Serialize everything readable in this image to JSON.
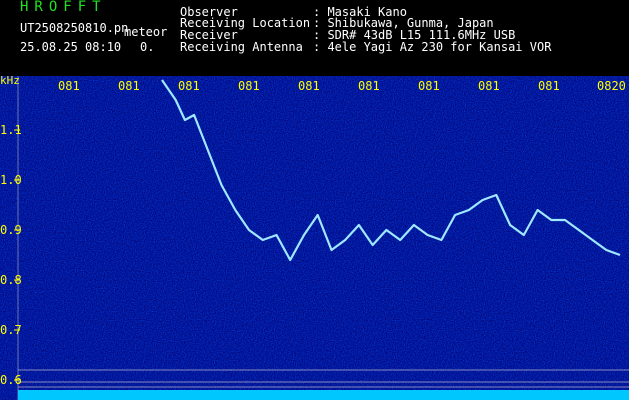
{
  "header": {
    "app_title": "HROFFT",
    "filename": "UT2508250810.pn",
    "mode": "meteor",
    "datetime": "25.08.25 08:10",
    "count": "0.",
    "observer_label": "Observer",
    "observer_value": ": Masaki Kano",
    "location_label": "Receiving Location",
    "location_value": ": Shibukawa, Gunma, Japan",
    "receiver_label": "Receiver",
    "receiver_value": ": SDR# 43dB L15 111.6MHz USB",
    "antenna_label": "Receiving Antenna",
    "antenna_value": ": 4ele Yagi Az 230 for Kansai VOR"
  },
  "spectrogram": {
    "freq_unit": "kHz",
    "time_ticks": [
      "081",
      "081",
      "081",
      "081",
      "081",
      "081",
      "081",
      "081",
      "081",
      "0820"
    ],
    "freq_ticks": [
      "1.1",
      "1.0",
      "0.9",
      "0.8",
      "0.7",
      "0.6"
    ],
    "freq_tick_values": [
      1.1,
      1.0,
      0.9,
      0.8,
      0.7,
      0.6
    ],
    "freq_range_khz": [
      0.6,
      1.19
    ],
    "colors": {
      "noise_background": "#04047a",
      "axis_labels": "#ffff00",
      "time_labels": "#ffff00",
      "signal": "#9fe8ff",
      "baseline": "#00c8ff"
    },
    "trace_khz": [
      {
        "t": 0.0,
        "f": 1.2
      },
      {
        "t": 0.03,
        "f": 1.16
      },
      {
        "t": 0.05,
        "f": 1.12
      },
      {
        "t": 0.07,
        "f": 1.13
      },
      {
        "t": 0.1,
        "f": 1.06
      },
      {
        "t": 0.13,
        "f": 0.99
      },
      {
        "t": 0.16,
        "f": 0.94
      },
      {
        "t": 0.19,
        "f": 0.9
      },
      {
        "t": 0.22,
        "f": 0.88
      },
      {
        "t": 0.25,
        "f": 0.89
      },
      {
        "t": 0.28,
        "f": 0.84
      },
      {
        "t": 0.31,
        "f": 0.89
      },
      {
        "t": 0.34,
        "f": 0.93
      },
      {
        "t": 0.37,
        "f": 0.86
      },
      {
        "t": 0.4,
        "f": 0.88
      },
      {
        "t": 0.43,
        "f": 0.91
      },
      {
        "t": 0.46,
        "f": 0.87
      },
      {
        "t": 0.49,
        "f": 0.9
      },
      {
        "t": 0.52,
        "f": 0.88
      },
      {
        "t": 0.55,
        "f": 0.91
      },
      {
        "t": 0.58,
        "f": 0.89
      },
      {
        "t": 0.61,
        "f": 0.88
      },
      {
        "t": 0.64,
        "f": 0.93
      },
      {
        "t": 0.67,
        "f": 0.94
      },
      {
        "t": 0.7,
        "f": 0.96
      },
      {
        "t": 0.73,
        "f": 0.97
      },
      {
        "t": 0.76,
        "f": 0.91
      },
      {
        "t": 0.79,
        "f": 0.89
      },
      {
        "t": 0.82,
        "f": 0.94
      },
      {
        "t": 0.85,
        "f": 0.92
      },
      {
        "t": 0.88,
        "f": 0.92
      },
      {
        "t": 0.91,
        "f": 0.9
      },
      {
        "t": 0.94,
        "f": 0.88
      },
      {
        "t": 0.97,
        "f": 0.86
      },
      {
        "t": 1.0,
        "f": 0.85
      }
    ]
  }
}
